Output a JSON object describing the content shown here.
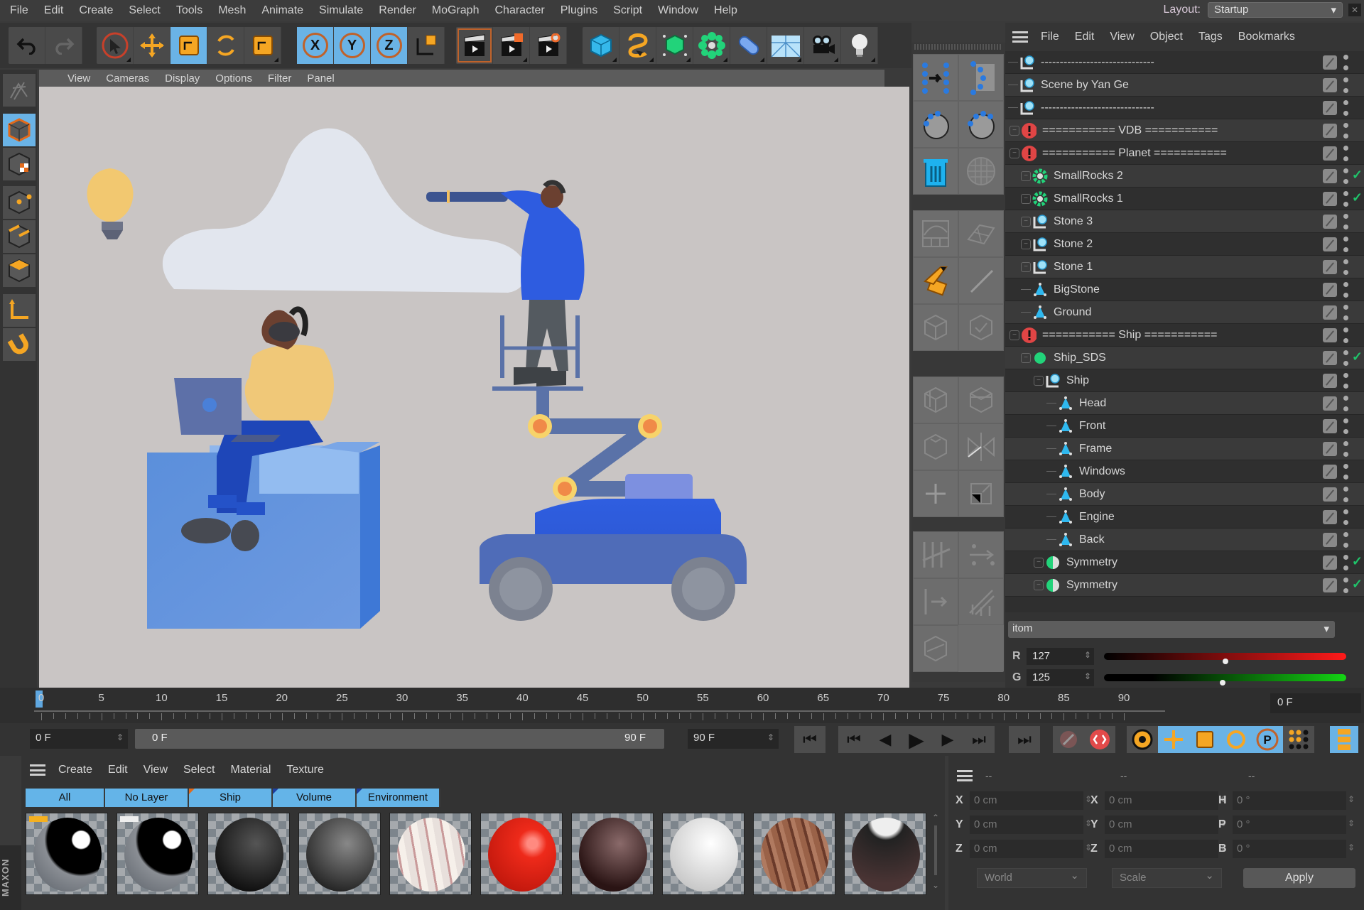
{
  "menubar": {
    "items": [
      "File",
      "Edit",
      "Create",
      "Select",
      "Tools",
      "Mesh",
      "Animate",
      "Simulate",
      "Render",
      "MoGraph",
      "Character",
      "Plugins",
      "Script",
      "Window",
      "Help"
    ],
    "layout_label": "Layout:",
    "layout_value": "Startup"
  },
  "toolbar": {
    "undo": "undo-icon",
    "redo": "redo-icon",
    "tools": [
      "live-selection",
      "move",
      "scale",
      "rotate",
      "recent-tool"
    ],
    "axes": [
      "X",
      "Y",
      "Z"
    ],
    "coordinate_system": "world-coordinates",
    "render": [
      "render-view",
      "render-to-picture-viewer",
      "render-settings"
    ],
    "create": [
      "cube",
      "spline-pen",
      "subdivision-surface",
      "cloner",
      "deformer",
      "floor",
      "camera",
      "light"
    ]
  },
  "viewport": {
    "menu": [
      "View",
      "Cameras",
      "Display",
      "Options",
      "Filter",
      "Panel"
    ]
  },
  "left_tools": [
    "edit-mode",
    "model-mode",
    "texture-mode",
    "points-mode",
    "edges-mode",
    "polygons-mode",
    "axis-mode",
    "snap-magnet"
  ],
  "object_manager": {
    "menu": [
      "File",
      "Edit",
      "View",
      "Object",
      "Tags",
      "Bookmarks"
    ],
    "rows": [
      {
        "name": "------------------------------",
        "icon": "null",
        "depth": 1,
        "check": false
      },
      {
        "name": "Scene by Yan Ge",
        "icon": "null",
        "depth": 1,
        "check": false
      },
      {
        "name": "------------------------------",
        "icon": "null",
        "depth": 1,
        "check": false
      },
      {
        "name": "=========== VDB ===========",
        "icon": "warning",
        "depth": 0,
        "check": false
      },
      {
        "name": "=========== Planet ===========",
        "icon": "warning",
        "depth": 0,
        "check": false
      },
      {
        "name": "SmallRocks 2",
        "icon": "cloner",
        "depth": 2,
        "check": true
      },
      {
        "name": "SmallRocks 1",
        "icon": "cloner",
        "depth": 2,
        "check": true
      },
      {
        "name": "Stone 3",
        "icon": "null",
        "depth": 2,
        "check": false
      },
      {
        "name": "Stone 2",
        "icon": "null",
        "depth": 2,
        "check": false
      },
      {
        "name": "Stone 1",
        "icon": "null",
        "depth": 2,
        "check": false
      },
      {
        "name": "BigStone",
        "icon": "polygon",
        "depth": 2,
        "check": false
      },
      {
        "name": "Ground",
        "icon": "polygon",
        "depth": 2,
        "check": false
      },
      {
        "name": "=========== Ship ===========",
        "icon": "warning",
        "depth": 0,
        "check": false
      },
      {
        "name": "Ship_SDS",
        "icon": "sds",
        "depth": 2,
        "check": true
      },
      {
        "name": "Ship",
        "icon": "null",
        "depth": 3,
        "check": false
      },
      {
        "name": "Head",
        "icon": "polygon",
        "depth": 4,
        "check": false
      },
      {
        "name": "Front",
        "icon": "polygon",
        "depth": 4,
        "check": false
      },
      {
        "name": "Frame",
        "icon": "polygon",
        "depth": 4,
        "check": false
      },
      {
        "name": "Windows",
        "icon": "polygon",
        "depth": 4,
        "check": false
      },
      {
        "name": "Body",
        "icon": "polygon",
        "depth": 4,
        "check": false
      },
      {
        "name": "Engine",
        "icon": "polygon",
        "depth": 4,
        "check": false
      },
      {
        "name": "Back",
        "icon": "polygon",
        "depth": 4,
        "check": false
      },
      {
        "name": "Symmetry",
        "icon": "symmetry",
        "depth": 3,
        "check": true
      },
      {
        "name": "Symmetry",
        "icon": "symmetry",
        "depth": 3,
        "check": true
      }
    ]
  },
  "attributes": {
    "dropdown": "itom",
    "r_label": "R",
    "r_value": "127",
    "r_fraction": 0.5,
    "g_label": "G",
    "g_value": "125",
    "g_fraction": 0.49
  },
  "timeline": {
    "ticks": [
      "0",
      "5",
      "10",
      "15",
      "20",
      "25",
      "30",
      "35",
      "40",
      "45",
      "50",
      "55",
      "60",
      "65",
      "70",
      "75",
      "80",
      "85",
      "90"
    ],
    "current_frame": "0 F",
    "start_field": "0 F",
    "range_start": "0 F",
    "range_end": "90 F",
    "end_field": "90 F",
    "max_frame": 90
  },
  "transport": {
    "buttons": [
      "go-to-start",
      "previous-key",
      "previous-frame",
      "play",
      "next-frame",
      "next-key",
      "go-to-end"
    ],
    "record": [
      "record-keys",
      "autokeying",
      "keyframe-selection",
      "position-key",
      "scale-key",
      "rotation-key",
      "parameter-key",
      "point-level-animation",
      "scheme"
    ]
  },
  "material_manager": {
    "menu": [
      "Create",
      "Edit",
      "View",
      "Select",
      "Material",
      "Texture"
    ],
    "tabs": [
      "All",
      "No Layer",
      "Ship",
      "Volume",
      "Environment"
    ],
    "materials": [
      "chrome-1",
      "chrome-2",
      "dark-gray",
      "gray",
      "white-stripe",
      "red",
      "dark-wood",
      "white",
      "brown-wood",
      "dark-chrome"
    ]
  },
  "coordinates": {
    "header": [
      "--",
      "--",
      "--"
    ],
    "position": [
      {
        "axis": "X",
        "value": "0 cm"
      },
      {
        "axis": "Y",
        "value": "0 cm"
      },
      {
        "axis": "Z",
        "value": "0 cm"
      }
    ],
    "size": [
      {
        "axis": "X",
        "value": "0 cm"
      },
      {
        "axis": "Y",
        "value": "0 cm"
      },
      {
        "axis": "Z",
        "value": "0 cm"
      }
    ],
    "rotation": [
      {
        "axis": "H",
        "value": "0 °"
      },
      {
        "axis": "P",
        "value": "0 °"
      },
      {
        "axis": "B",
        "value": "0 °"
      }
    ],
    "mode": "World",
    "size_mode": "Scale",
    "apply": "Apply"
  },
  "brand": "MAXON",
  "colors": {
    "accent": "#6ab3e6",
    "orange": "#f39c12",
    "warning": "#e04545",
    "green": "#1fc46a"
  }
}
